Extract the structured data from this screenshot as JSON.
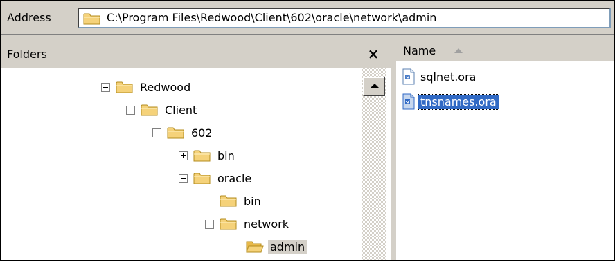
{
  "address": {
    "label": "Address",
    "path": "C:\\Program Files\\Redwood\\Client\\602\\oracle\\network\\admin"
  },
  "folders": {
    "title": "Folders",
    "close_glyph": "×",
    "tree": [
      {
        "label": "Redwood",
        "expander": "minus"
      },
      {
        "label": "Client",
        "expander": "minus"
      },
      {
        "label": "602",
        "expander": "minus"
      },
      {
        "label": "bin",
        "expander": "plus"
      },
      {
        "label": "oracle",
        "expander": "minus"
      },
      {
        "label": "bin",
        "expander": "none"
      },
      {
        "label": "network",
        "expander": "minus"
      },
      {
        "label": "admin",
        "expander": "none",
        "selected": true,
        "open": true
      }
    ]
  },
  "files": {
    "column_name": "Name",
    "items": [
      {
        "label": "sqlnet.ora",
        "selected": false
      },
      {
        "label": "tnsnames.ora",
        "selected": true
      }
    ]
  },
  "colors": {
    "folder": "#f5d27a",
    "folder_outline": "#b48c1e",
    "selection": "#316ac5",
    "chrome": "#d4d0c8"
  }
}
